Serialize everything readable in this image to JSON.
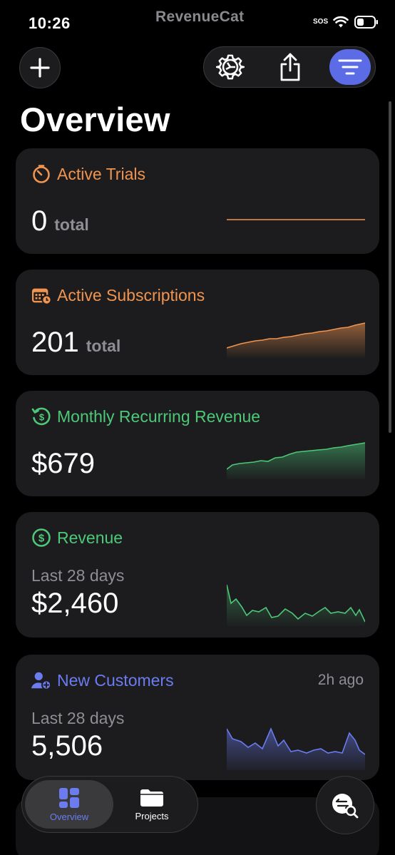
{
  "status_bar": {
    "time": "10:26",
    "brand": "RevenueCat",
    "sos": "SOS",
    "wifi_icon": "wifi-icon",
    "battery_icon": "battery-icon"
  },
  "toolbar": {
    "add_icon": "plus-icon",
    "settings_icon": "gear-icon",
    "share_icon": "share-icon",
    "filter_icon": "filter-lines-icon",
    "accent_color": "#5b6ce6"
  },
  "page_title": "Overview",
  "cards": {
    "active_trials": {
      "title": "Active Trials",
      "value": "0",
      "unit": "total",
      "icon": "timer-icon",
      "color": "#f0944f"
    },
    "active_subscriptions": {
      "title": "Active Subscriptions",
      "value": "201",
      "unit": "total",
      "icon": "calendar-icon",
      "color": "#f0944f"
    },
    "mrr": {
      "title": "Monthly Recurring Revenue",
      "value": "$679",
      "icon": "recurring-dollar-icon",
      "color": "#4dc878"
    },
    "revenue": {
      "title": "Revenue",
      "period": "Last 28 days",
      "value": "$2,460",
      "icon": "dollar-circle-icon",
      "color": "#4dc878"
    },
    "new_customers": {
      "title": "New Customers",
      "updated": "2h ago",
      "period": "Last 28 days",
      "value": "5,506",
      "icon": "person-add-icon",
      "color": "#6a7cf0"
    }
  },
  "tab_bar": {
    "tabs": [
      {
        "label": "Overview",
        "icon": "dashboard-grid-icon",
        "active": true
      },
      {
        "label": "Projects",
        "icon": "folder-icon",
        "active": false
      }
    ]
  },
  "search_button_icon": "transactions-search-icon"
}
